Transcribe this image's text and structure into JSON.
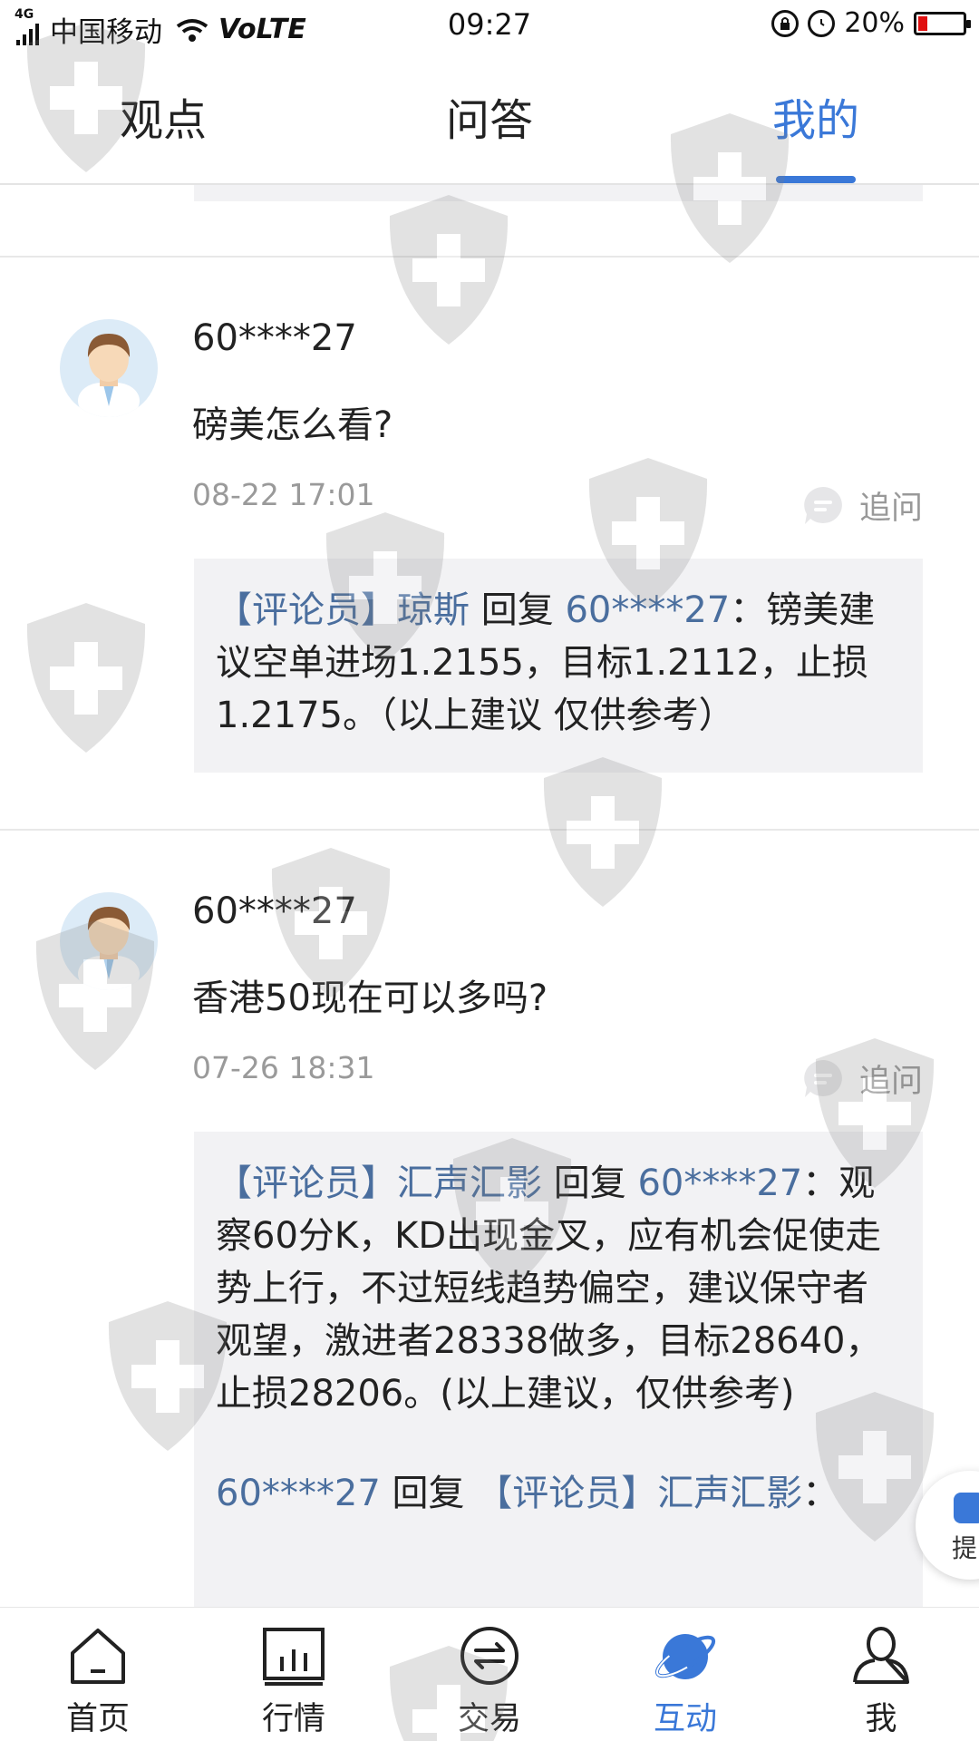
{
  "status_bar": {
    "network_badge": "4G",
    "carrier": "中国移动",
    "volte": "VoLTE",
    "time": "09:27",
    "battery": "20%",
    "battery_level": 0.2,
    "battery_fill_color": "#e01010"
  },
  "tabs": [
    {
      "label": "观点",
      "active": false
    },
    {
      "label": "问答",
      "active": false
    },
    {
      "label": "我的",
      "active": true
    }
  ],
  "accent_color": "#3a78d8",
  "items": [
    {
      "user": "60****27",
      "question": "磅美怎么看?",
      "time": "08-22 17:01",
      "followup": "追问",
      "replies": [
        {
          "prefix": "【评论员】琼斯",
          "verb": " 回复 ",
          "target": "60****27",
          "text": "：镑美建议空单进场1.2155，目标1.2112，止损1.2175。（以上建议 仅供参考）"
        }
      ]
    },
    {
      "user": "60****27",
      "question": "香港50现在可以多吗?",
      "time": "07-26 18:31",
      "followup": "追问",
      "replies": [
        {
          "prefix": "【评论员】汇声汇影",
          "verb": " 回复 ",
          "target": "60****27",
          "text": "：观察60分K，KD出现金叉，应有机会促使走势上行，不过短线趋势偏空，建议保守者观望，激进者28338做多，目标28640，止损28206。(以上建议，仅供参考)"
        },
        {
          "prefix": "60****27",
          "verb": " 回复 ",
          "target": "【评论员】汇声汇影",
          "text": "："
        }
      ]
    }
  ],
  "float_button": {
    "label": "提"
  },
  "bottom_nav": [
    {
      "label": "首页",
      "icon": "home-icon",
      "active": false
    },
    {
      "label": "行情",
      "icon": "market-chart-icon",
      "active": false
    },
    {
      "label": "交易",
      "icon": "exchange-icon",
      "active": false
    },
    {
      "label": "互动",
      "icon": "planet-icon",
      "active": true
    },
    {
      "label": "我",
      "icon": "profile-icon",
      "active": false
    }
  ]
}
